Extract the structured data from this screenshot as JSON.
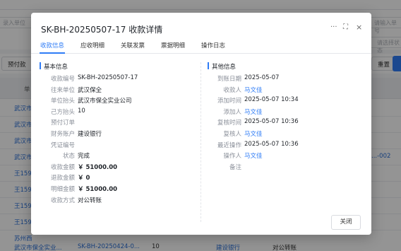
{
  "background": {
    "filters": {
      "search_placeholder_left": "录入单位",
      "search_placeholder_right": "请输入单号",
      "select_placeholder": "请选择状态"
    },
    "toolbar": {
      "prepay_label": "预付款",
      "reset_label": "重置"
    },
    "table": {
      "header_col2": "单",
      "rows": [
        {
          "unit": "武汉市",
          "no": "",
          "ref": ""
        },
        {
          "unit": "武汉市",
          "no": "",
          "ref": ""
        },
        {
          "unit": "武汉市",
          "no": "",
          "ref": ""
        },
        {
          "unit": "武汉市",
          "no": "",
          "ref": "...-002"
        },
        {
          "unit": "王159",
          "no": "",
          "ref": ""
        },
        {
          "unit": "王159",
          "no": "",
          "ref": ""
        },
        {
          "unit": "王159",
          "no": "",
          "ref": ""
        },
        {
          "unit": "王159",
          "no": "",
          "ref": ""
        },
        {
          "unit": "苏州西",
          "no": "",
          "ref": ""
        }
      ],
      "last_row": {
        "unit": "武汉市保全实业...",
        "no": "SK-BH-20250424-0...",
        "count": "10",
        "bank": "建设银行",
        "method": "对公转账"
      }
    }
  },
  "modal": {
    "title": "SK-BH-20250507-17 收款详情",
    "more_icon": "···",
    "expand_icon": "⛶",
    "close_icon": "×",
    "tabs": [
      "收款信息",
      "应收明细",
      "关联发票",
      "票据明细",
      "操作日志"
    ],
    "active_tab_index": 0,
    "basic": {
      "section_title": "基本信息",
      "fields": [
        {
          "label": "收款编号",
          "value": "SK-BH-20250507-17",
          "style": ""
        },
        {
          "label": "往来单位",
          "value": "武汉保全",
          "style": ""
        },
        {
          "label": "单位抬头",
          "value": "武汉市保全实业公司",
          "style": ""
        },
        {
          "label": "己方抬头",
          "value": "10",
          "style": ""
        },
        {
          "label": "预付订单",
          "value": "",
          "style": ""
        },
        {
          "label": "财务账户",
          "value": "建设银行",
          "style": ""
        },
        {
          "label": "凭证编号",
          "value": "",
          "style": ""
        },
        {
          "label": "状态",
          "value": "完成",
          "style": ""
        },
        {
          "label": "收款金额",
          "value": "￥ 51000.00",
          "style": "bold"
        },
        {
          "label": "退款金额",
          "value": "￥ 0",
          "style": "bold"
        },
        {
          "label": "明细金额",
          "value": "￥ 51000.00",
          "style": "bold"
        },
        {
          "label": "收款方式",
          "value": "对公转账",
          "style": ""
        }
      ]
    },
    "other": {
      "section_title": "其他信息",
      "fields": [
        {
          "label": "到账日期",
          "value": "2025-05-07",
          "style": ""
        },
        {
          "label": "收款人",
          "value": "马文佳",
          "style": "link"
        },
        {
          "label": "添加时间",
          "value": "2025-05-07 10:34",
          "style": ""
        },
        {
          "label": "添加人",
          "value": "马文佳",
          "style": "link"
        },
        {
          "label": "复核时间",
          "value": "2025-05-07 10:36",
          "style": ""
        },
        {
          "label": "复核人",
          "value": "马文佳",
          "style": "link"
        },
        {
          "label": "最近操作",
          "value": "2025-05-07 10:36",
          "style": ""
        },
        {
          "label": "操作人",
          "value": "马文佳",
          "style": "link"
        },
        {
          "label": "备注",
          "value": "",
          "style": ""
        }
      ]
    },
    "close_button_label": "关闭"
  },
  "colors": {
    "accent": "#2f7cf6",
    "link": "#2f7cf6",
    "overlay": "rgba(0,0,0,0.42)"
  }
}
